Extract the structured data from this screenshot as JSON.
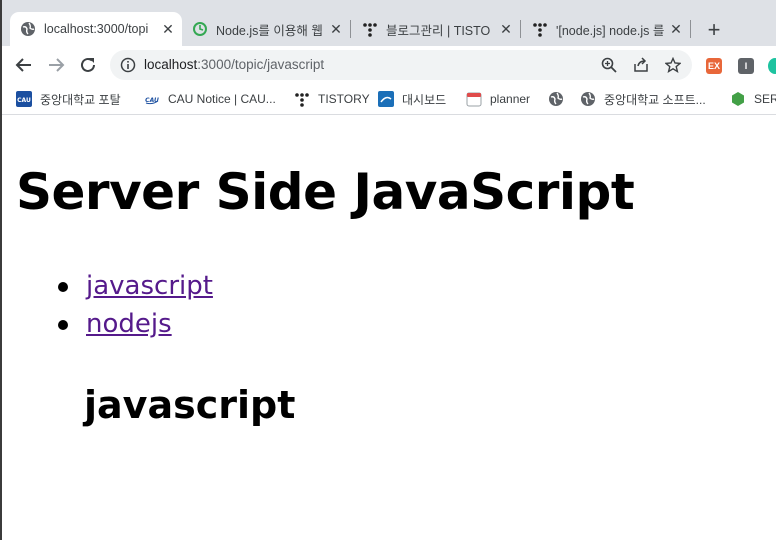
{
  "tabs": [
    {
      "title": "localhost:3000/topi",
      "icon": "globe-icon",
      "active": true
    },
    {
      "title": "Node.js를 이용해 웹",
      "icon": "green-circle-icon",
      "active": false
    },
    {
      "title": "블로그관리 | TISTO",
      "icon": "tistory-icon",
      "active": false
    },
    {
      "title": "'[node.js] node.js 를",
      "icon": "tistory-icon",
      "active": false
    }
  ],
  "close_glyph": "✕",
  "new_tab_glyph": "+",
  "address": {
    "host": "localhost",
    "path": ":3000/topic/javascript"
  },
  "extensions": [
    {
      "name": "ex-extension-icon",
      "label": "EX",
      "color": "#e8673a"
    },
    {
      "name": "i-extension-icon",
      "label": "I",
      "color": "#5f6368"
    },
    {
      "name": "green-extension-icon",
      "label": "",
      "color": "#1ec3a0"
    }
  ],
  "bookmarks": [
    {
      "label": "중앙대학교 포탈",
      "icon": "cau-icon"
    },
    {
      "label": "CAU Notice | CAU...",
      "icon": "cau-logo-icon"
    },
    {
      "label": "TISTORY",
      "icon": "tistory-icon"
    },
    {
      "label": "대시보드",
      "icon": "cau-icon"
    },
    {
      "label": "planner",
      "icon": "calendar-icon"
    },
    {
      "label": "",
      "icon": "globe-icon"
    },
    {
      "label": "중앙대학교 소프트...",
      "icon": "globe-icon"
    },
    {
      "label": "SERV",
      "icon": "node-icon"
    }
  ],
  "content": {
    "heading": "Server Side JavaScript",
    "links": [
      "javascript",
      "nodejs"
    ],
    "subheading": "javascript"
  }
}
